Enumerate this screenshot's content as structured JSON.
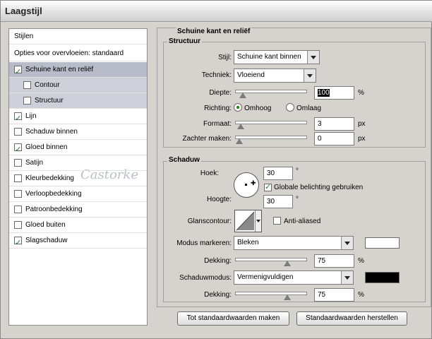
{
  "window": {
    "title": "Laagstijl"
  },
  "left_panel": {
    "items": [
      {
        "label": "Stijlen",
        "has_checkbox": false,
        "checked": false,
        "selected": false,
        "sub": false
      },
      {
        "label": "Opties voor overvloeien: standaard",
        "has_checkbox": false,
        "checked": false,
        "selected": false,
        "sub": false
      },
      {
        "label": "Schuine kant en reliëf",
        "has_checkbox": true,
        "checked": true,
        "selected": true,
        "sub": false
      },
      {
        "label": "Contour",
        "has_checkbox": true,
        "checked": false,
        "selected": false,
        "sub": true
      },
      {
        "label": "Structuur",
        "has_checkbox": true,
        "checked": false,
        "selected": false,
        "sub": true
      },
      {
        "label": "Lijn",
        "has_checkbox": true,
        "checked": true,
        "selected": false,
        "sub": false
      },
      {
        "label": "Schaduw binnen",
        "has_checkbox": true,
        "checked": false,
        "selected": false,
        "sub": false
      },
      {
        "label": "Gloed binnen",
        "has_checkbox": true,
        "checked": true,
        "selected": false,
        "sub": false
      },
      {
        "label": "Satijn",
        "has_checkbox": true,
        "checked": false,
        "selected": false,
        "sub": false
      },
      {
        "label": "Kleurbedekking",
        "has_checkbox": true,
        "checked": false,
        "selected": false,
        "sub": false
      },
      {
        "label": "Verloopbedekking",
        "has_checkbox": true,
        "checked": false,
        "selected": false,
        "sub": false
      },
      {
        "label": "Patroonbedekking",
        "has_checkbox": true,
        "checked": false,
        "selected": false,
        "sub": false
      },
      {
        "label": "Gloed buiten",
        "has_checkbox": true,
        "checked": false,
        "selected": false,
        "sub": false
      },
      {
        "label": "Slagschaduw",
        "has_checkbox": true,
        "checked": true,
        "selected": false,
        "sub": false
      }
    ],
    "watermark": "Castorke"
  },
  "bevel": {
    "section_title": "Schuine kant en reliëf",
    "structure_title": "Structuur",
    "style_label": "Stijl:",
    "style_value": "Schuine kant binnen",
    "technique_label": "Techniek:",
    "technique_value": "Vloeiend",
    "depth_label": "Diepte:",
    "depth_value": "100",
    "depth_unit": "%",
    "depth_slider": 0.05,
    "direction_label": "Richting:",
    "direction_up": "Omhoog",
    "direction_down": "Omlaag",
    "direction_selected": "up",
    "size_label": "Formaat:",
    "size_value": "3",
    "size_unit": "px",
    "size_slider": 0.02,
    "soften_label": "Zachter maken:",
    "soften_value": "0",
    "soften_unit": "px",
    "soften_slider": 0.0
  },
  "shading": {
    "title": "Schaduw",
    "angle_label": "Hoek:",
    "angle_value": "30",
    "angle_unit": "°",
    "global_light_label": "Globale belichting gebruiken",
    "global_light_checked": true,
    "altitude_label": "Hoogte:",
    "altitude_value": "30",
    "altitude_unit": "°",
    "gloss_label": "Glanscontour:",
    "antialiased_label": "Anti-aliased",
    "antialiased_checked": false,
    "highlight_mode_label": "Modus markeren:",
    "highlight_mode_value": "Bleken",
    "highlight_color": "#ffffff",
    "highlight_opacity_label": "Dekking:",
    "highlight_opacity_value": "75",
    "highlight_opacity_unit": "%",
    "highlight_opacity_slider": 0.75,
    "shadow_mode_label": "Schaduwmodus:",
    "shadow_mode_value": "Vermenigvuldigen",
    "shadow_color": "#000000",
    "shadow_opacity_label": "Dekking:",
    "shadow_opacity_value": "75",
    "shadow_opacity_unit": "%",
    "shadow_opacity_slider": 0.75
  },
  "buttons": {
    "make_default": "Tot standaardwaarden maken",
    "reset_default": "Standaardwaarden herstellen"
  }
}
